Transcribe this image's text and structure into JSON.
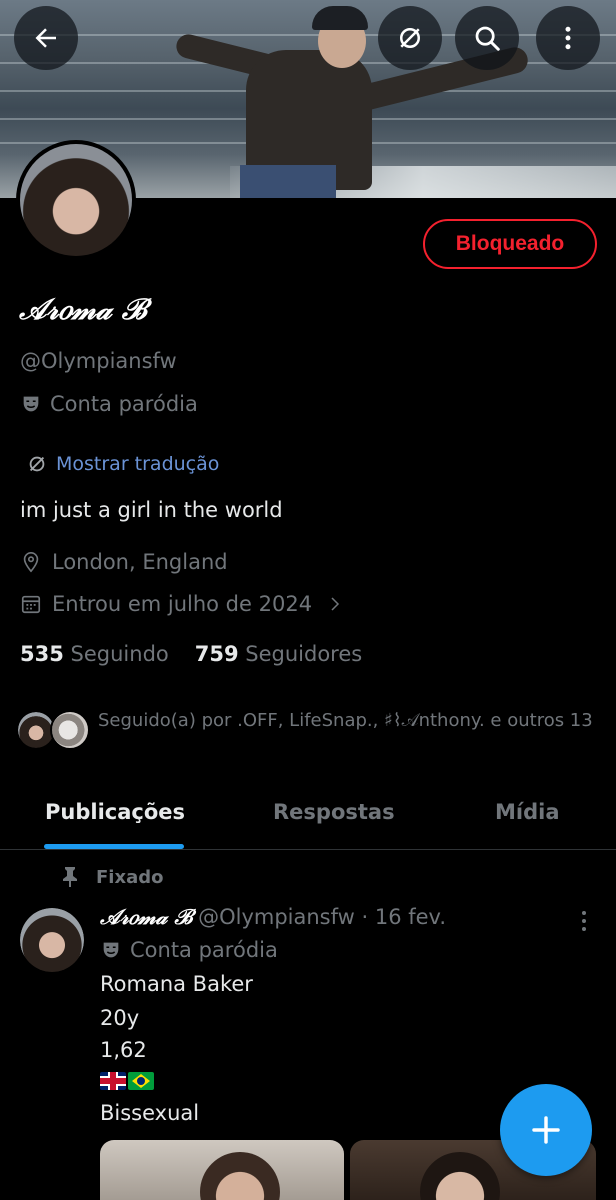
{
  "profile": {
    "display_name": "𝒜𝓇𝑜𝓂𝒶 ℬ",
    "handle": "@Olympiansfw",
    "parody_label": "Conta paródia",
    "blocked_label": "Bloqueado",
    "translate_label": "Mostrar tradução",
    "bio": "im just a girl in the world",
    "location": "London, England",
    "joined": "Entrou em julho de 2024",
    "following_count": "535",
    "following_label": "Seguindo",
    "followers_count": "759",
    "followers_label": "Seguidores",
    "followed_by": "Seguido(a) por .OFF, LifeSnap., ♯⌇𝒜nthony. e outros 13"
  },
  "tabs": [
    "Publicações",
    "Respostas",
    "Mídia"
  ],
  "pinned_label": "Fixado",
  "post": {
    "name": "𝒜𝓇𝑜𝓂𝒶 ℬ",
    "meta": "@Olympiansfw · 16 fev.",
    "parody_label": "Conta paródia",
    "lines": [
      "Romana Baker",
      "20y",
      "1,62",
      "Bissexual"
    ]
  },
  "icons": {
    "back": "back-arrow-icon",
    "translate": "translate-icon",
    "search": "search-icon",
    "more": "more-vertical-icon",
    "parody": "parody-mask-icon",
    "location": "location-pin-icon",
    "calendar": "calendar-icon",
    "pin": "pin-icon",
    "compose": "plus-icon"
  },
  "colors": {
    "accent": "#1d9bf0",
    "blocked": "#f4212e",
    "muted": "#71767b",
    "link": "#6b93d6"
  }
}
